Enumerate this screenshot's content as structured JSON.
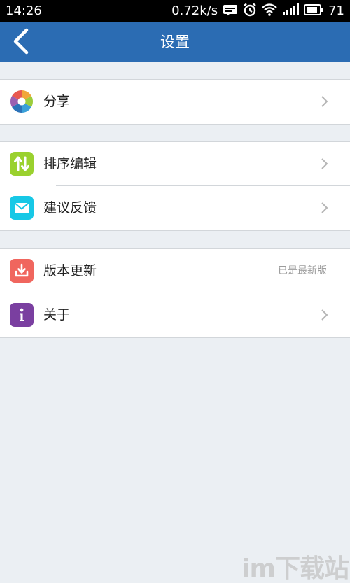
{
  "status_bar": {
    "time": "14:26",
    "network_speed": "0.72k/s",
    "battery_level": "71",
    "icons": [
      "message-icon",
      "alarm-icon",
      "wifi-icon",
      "signal-icon",
      "battery-icon"
    ]
  },
  "app_bar": {
    "title": "设置",
    "background_color": "#2b6cb3"
  },
  "groups": [
    {
      "items": [
        {
          "label": "分享",
          "icon": "share-icon",
          "icon_color": "multicolor",
          "trailing": "chevron"
        }
      ]
    },
    {
      "items": [
        {
          "label": "排序编辑",
          "icon": "sort-icon",
          "icon_color": "#9ad12e",
          "trailing": "chevron"
        },
        {
          "label": "建议反馈",
          "icon": "mail-icon",
          "icon_color": "#17c8e6",
          "trailing": "chevron"
        }
      ]
    },
    {
      "items": [
        {
          "label": "版本更新",
          "icon": "download-icon",
          "icon_color": "#f0665e",
          "trailing": "status",
          "status_text": "已是最新版"
        },
        {
          "label": "关于",
          "icon": "info-icon",
          "icon_color": "#7a3fa0",
          "trailing": "chevron"
        }
      ]
    }
  ],
  "watermark": {
    "text": "im下载站"
  }
}
